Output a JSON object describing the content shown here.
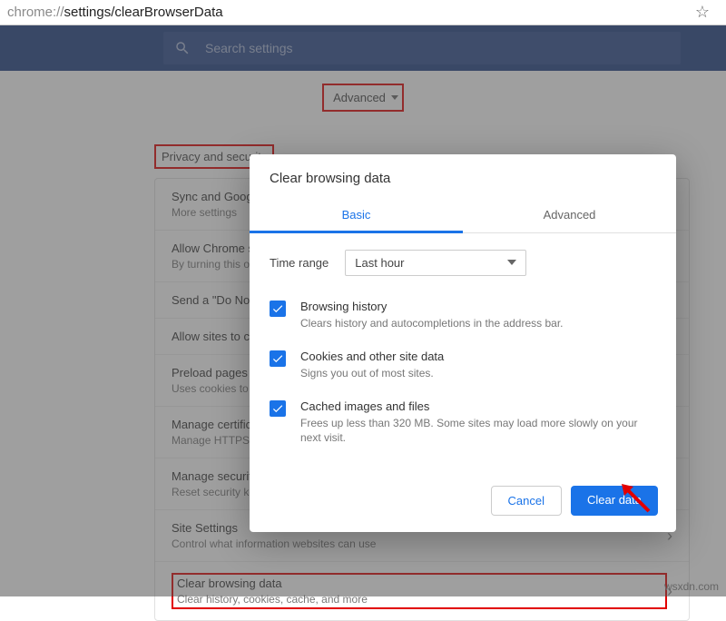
{
  "address": {
    "prefix": "chrome://",
    "bold": "settings/clearBrowserData"
  },
  "search": {
    "placeholder": "Search settings"
  },
  "page_tab": {
    "advanced": "Advanced"
  },
  "section_title": "Privacy and security",
  "rows": {
    "sync": {
      "title": "Sync and Google services",
      "sub": "More settings"
    },
    "signin": {
      "title": "Allow Chrome sign-in",
      "sub": "By turning this off..."
    },
    "dnt": {
      "title": "Send a \"Do Not Track\" request"
    },
    "sites": {
      "title": "Allow sites to check if you have payment methods"
    },
    "preload": {
      "title": "Preload pages for faster browsing",
      "sub": "Uses cookies to remember your preferences"
    },
    "certs": {
      "title": "Manage certificates",
      "sub": "Manage HTTPS/SSL certificates and settings"
    },
    "security": {
      "title": "Manage security keys",
      "sub": "Reset security keys and create PINs"
    },
    "site": {
      "title": "Site Settings",
      "sub": "Control what information websites can use"
    },
    "clear": {
      "title": "Clear browsing data",
      "sub": "Clear history, cookies, cache, and more"
    }
  },
  "dialog": {
    "title": "Clear browsing data",
    "tabs": {
      "basic": "Basic",
      "advanced": "Advanced"
    },
    "time_label": "Time range",
    "time_value": "Last hour",
    "options": [
      {
        "title": "Browsing history",
        "sub": "Clears history and autocompletions in the address bar."
      },
      {
        "title": "Cookies and other site data",
        "sub": "Signs you out of most sites."
      },
      {
        "title": "Cached images and files",
        "sub": "Frees up less than 320 MB. Some sites may load more slowly on your next visit."
      }
    ],
    "cancel": "Cancel",
    "clear": "Clear data"
  },
  "watermark": "wsxdn.com"
}
